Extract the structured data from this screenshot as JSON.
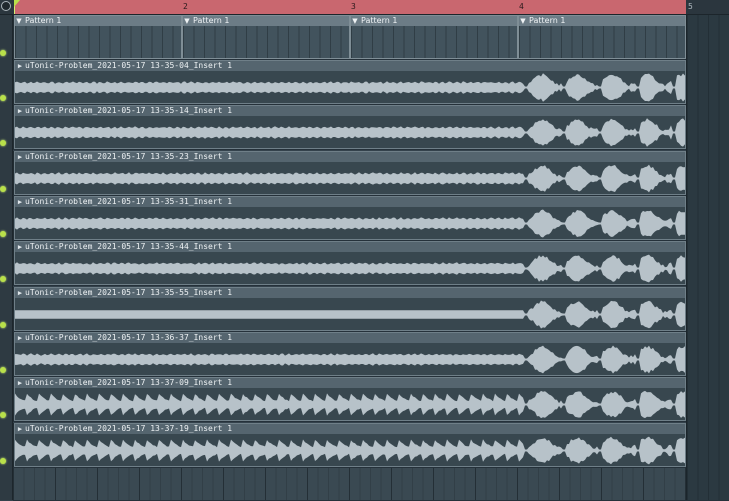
{
  "ruler": {
    "bars": [
      "2",
      "3",
      "4",
      "5"
    ]
  },
  "patterns": [
    "Pattern 1",
    "Pattern 1",
    "Pattern 1",
    "Pattern 1"
  ],
  "audio_clips": [
    {
      "name": "uTonic-Problem_2021-05-17 13-35-04_Insert 1"
    },
    {
      "name": "uTonic-Problem_2021-05-17 13-35-14_Insert 1"
    },
    {
      "name": "uTonic-Problem_2021-05-17 13-35-23_Insert 1"
    },
    {
      "name": "uTonic-Problem_2021-05-17 13-35-31_Insert 1"
    },
    {
      "name": "uTonic-Problem_2021-05-17 13-35-44_Insert 1"
    },
    {
      "name": "uTonic-Problem_2021-05-17 13-35-55_Insert 1"
    },
    {
      "name": "uTonic-Problem_2021-05-17 13-36-37_Insert 1"
    },
    {
      "name": "uTonic-Problem_2021-05-17 13-37-09_Insert 1"
    },
    {
      "name": "uTonic-Problem_2021-05-17 13-37-19_Insert 1"
    }
  ],
  "colors": {
    "loop_region": "#c9676f",
    "led": "#b9e04a",
    "waveform": "#b7c2c9",
    "clip_header": "#55656f",
    "background": "#34424c"
  },
  "icons": {
    "pattern_menu": "chevron-down-icon",
    "audio_clip": "audio-clip-icon",
    "track_led": "track-led-icon"
  }
}
